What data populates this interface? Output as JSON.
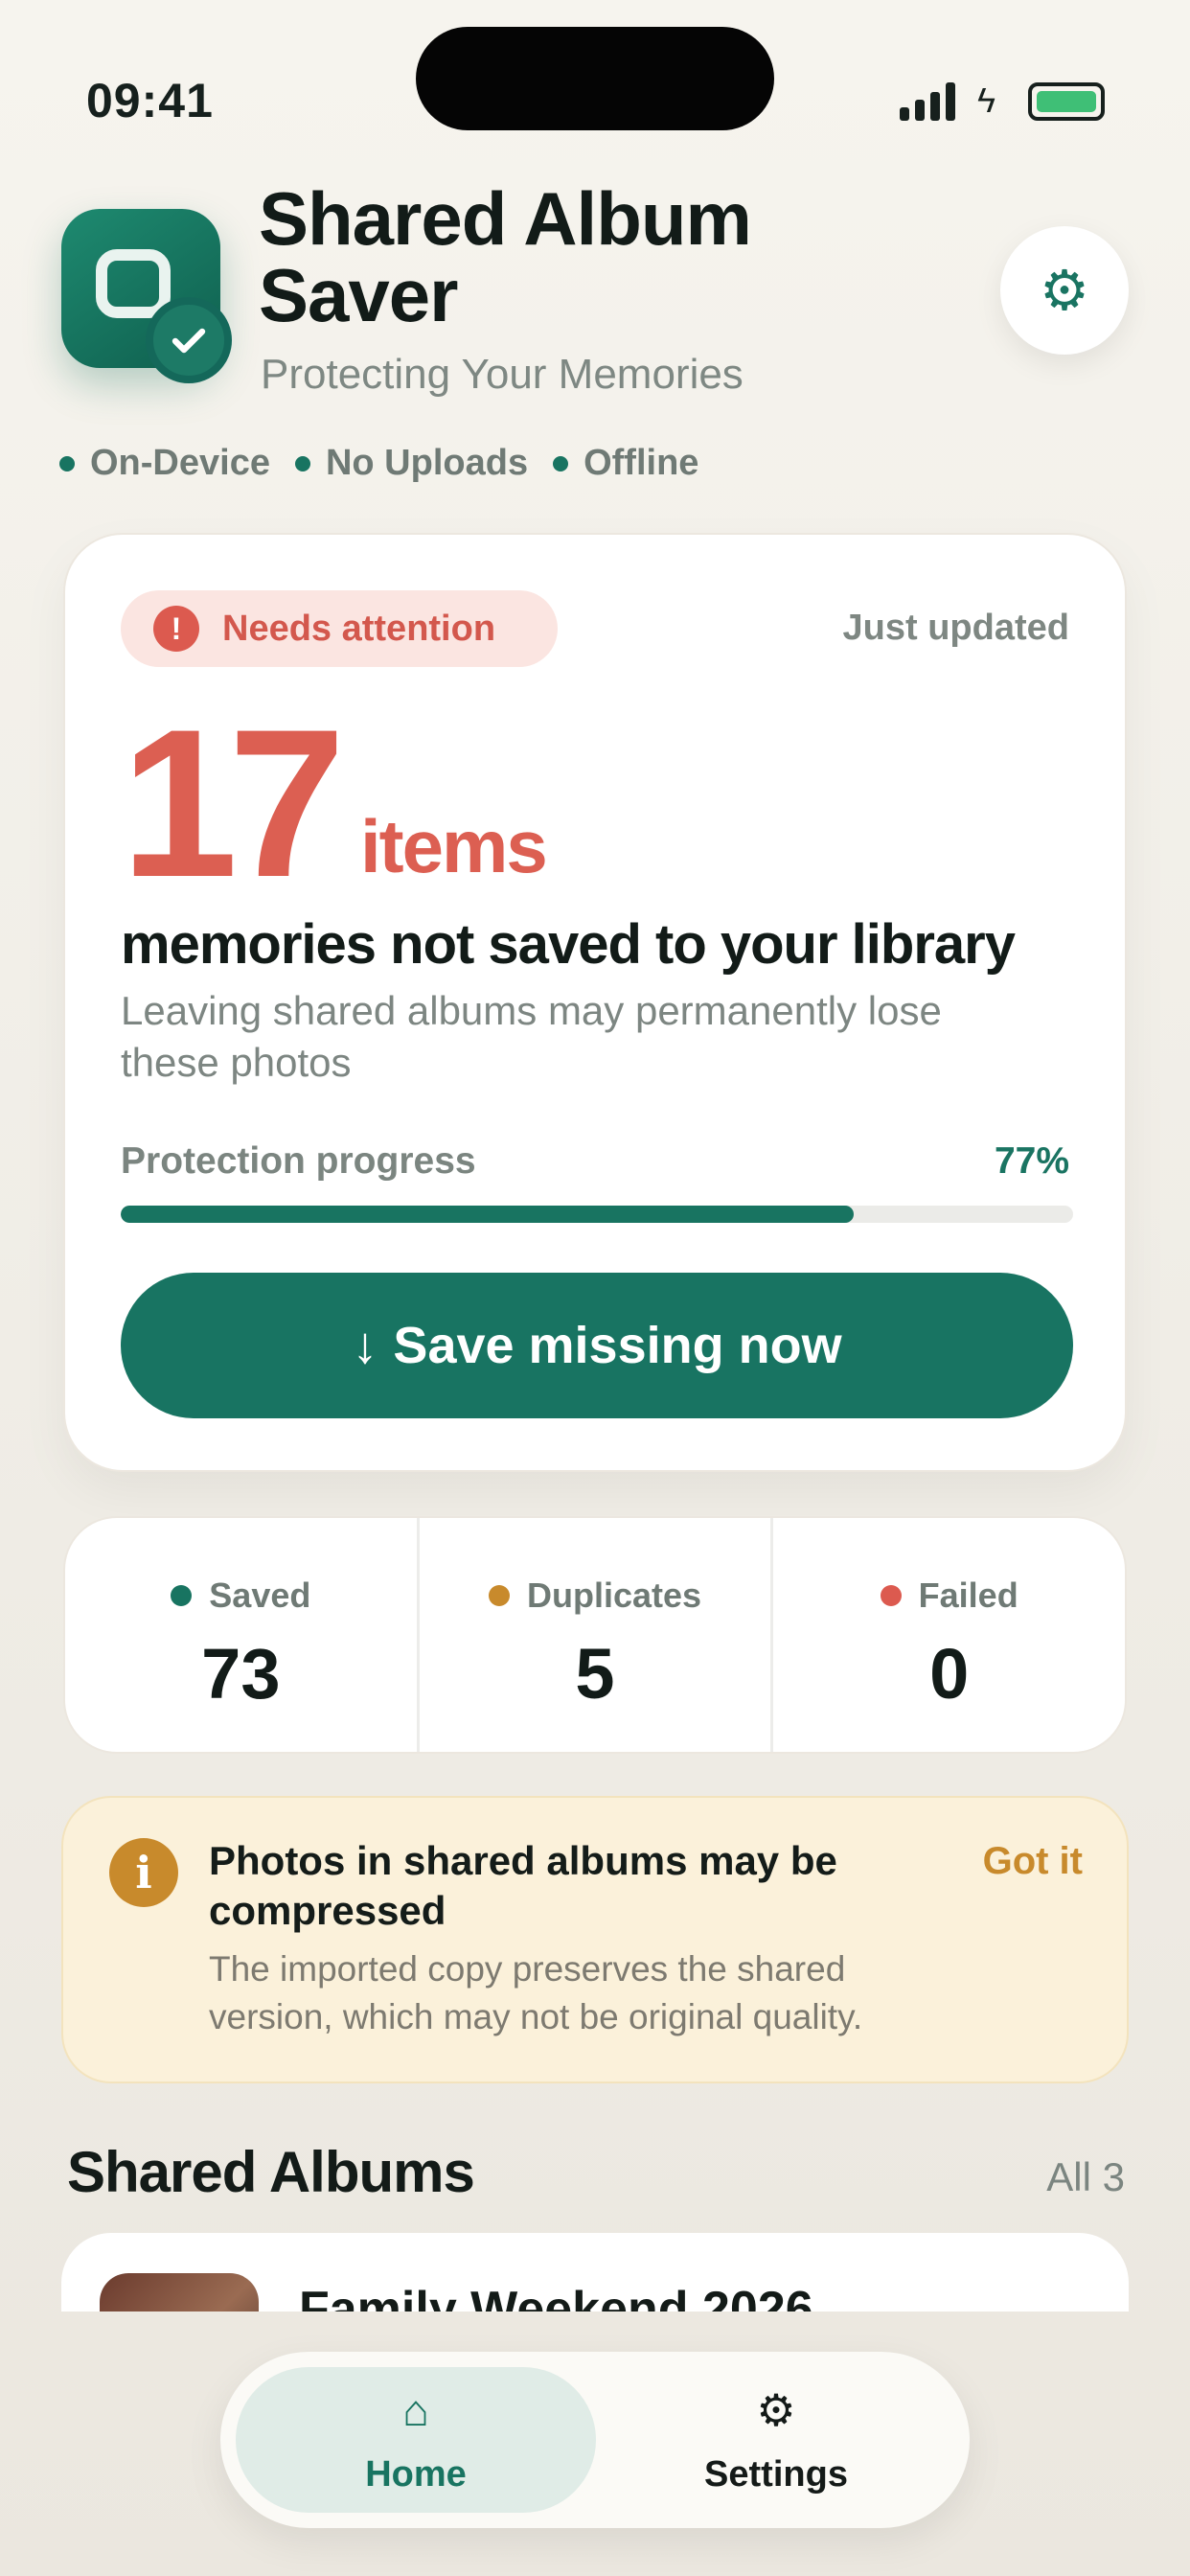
{
  "status_bar": {
    "time": "09:41",
    "battery_color": "#3fbf76"
  },
  "header": {
    "title": "Shared Album Saver",
    "subtitle": "Protecting Your Memories",
    "settings_icon": "gear-icon",
    "chips": [
      "On-Device",
      "No Uploads",
      "Offline"
    ]
  },
  "summary": {
    "badge": "Needs attention",
    "badge_icon": "!",
    "updated": "Just updated",
    "count": "17",
    "count_unit": "items",
    "heading": "memories not saved to your library",
    "description": "Leaving shared albums may permanently lose these photos",
    "progress_label": "Protection progress",
    "progress_text": "77%",
    "progress_value": 0.77,
    "action_arrow": "↓",
    "action_label": "Save missing now",
    "accent_color": "#187461",
    "alert_color": "#dc5f52"
  },
  "stats": [
    {
      "label": "Saved",
      "value": "73",
      "color": "#187461"
    },
    {
      "label": "Duplicates",
      "value": "5",
      "color": "#c88a2c"
    },
    {
      "label": "Failed",
      "value": "0",
      "color": "#dc5a4f"
    }
  ],
  "notice": {
    "icon": "i",
    "title": "Photos in shared albums may be compressed",
    "body": "The imported copy preserves the shared version, which may not be original quality.",
    "action": "Got it"
  },
  "albums": {
    "title": "Shared Albums",
    "link": "All 3",
    "items": [
      {
        "name": "Family Weekend 2026"
      }
    ]
  },
  "tabbar": {
    "tabs": [
      {
        "label": "Home",
        "icon": "⌂"
      },
      {
        "label": "Settings",
        "icon": "⚙"
      }
    ]
  }
}
